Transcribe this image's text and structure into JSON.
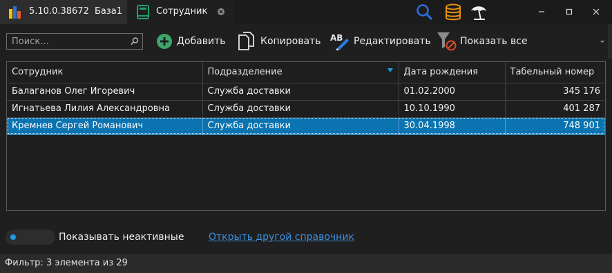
{
  "titlebar": {
    "app_version": "5.10.0.38672",
    "database": "База1",
    "tab_title": "Сотрудник",
    "icons": [
      "search-icon",
      "database-icon",
      "beach-umbrella-icon"
    ],
    "window_buttons": [
      "minimize",
      "maximize",
      "close"
    ]
  },
  "toolbar": {
    "search_placeholder": "Поиск...",
    "add_label": "Добавить",
    "copy_label": "Копировать",
    "edit_label": "Редактировать",
    "show_all_label": "Показать все"
  },
  "table": {
    "columns": [
      "Сотрудник",
      "Подразделение",
      "Дата рождения",
      "Табельный номер"
    ],
    "rows": [
      {
        "name": "Балаганов Олег Игоревич",
        "department": "Служба доставки",
        "birth_date": "01.02.2000",
        "number": "345 176"
      },
      {
        "name": "Игнатьева Лилия Александровна",
        "department": "Служба доставки",
        "birth_date": "10.10.1990",
        "number": "401 287"
      },
      {
        "name": "Кремнев Сергей Романович",
        "department": "Служба доставки",
        "birth_date": "30.04.1998",
        "number": "748 901"
      }
    ],
    "selected_row": 2,
    "filtered_column": "Подразделение"
  },
  "footer": {
    "toggle_label": "Показывать неактивные",
    "toggle_on": false,
    "link_text": "Открыть другой справочник",
    "status_text": "Фильтр: 3 элемента из 29"
  },
  "colors": {
    "background": "#1f1f1f",
    "selection": "#0a73b0",
    "accent": "#1e9be9",
    "link": "#3b8fe0",
    "add_green": "#3da66a",
    "filter_red": "#e34b2a"
  }
}
